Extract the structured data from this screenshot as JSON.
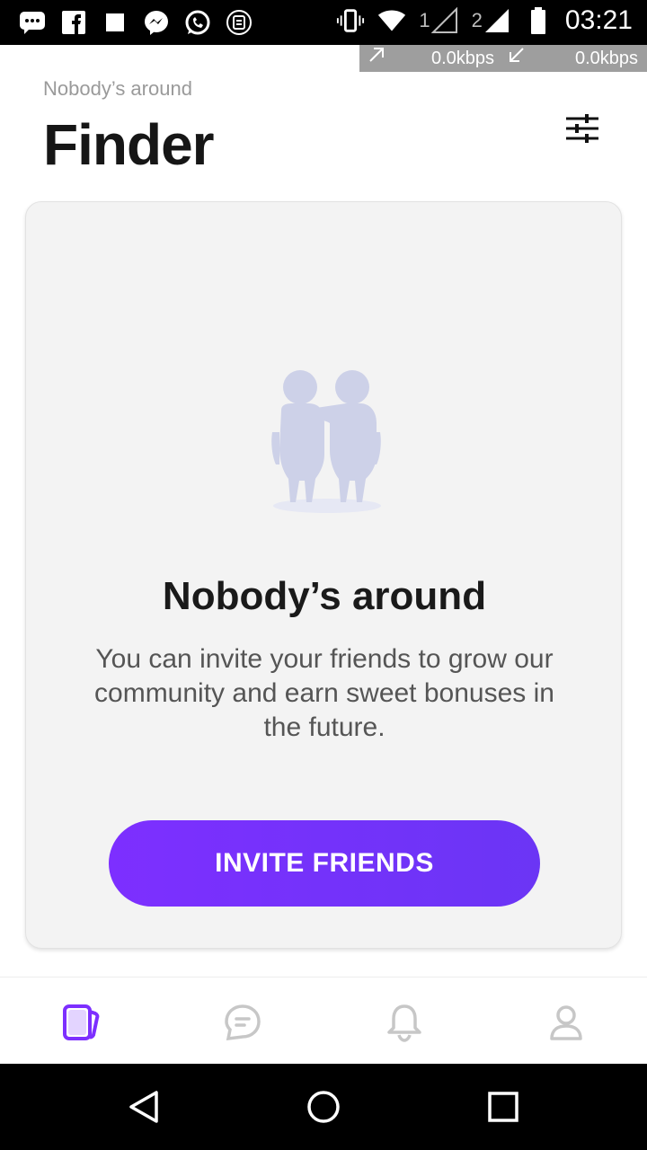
{
  "status_bar": {
    "time": "03:21",
    "sim1": "1",
    "sim2": "2",
    "icons": [
      "messages-icon",
      "facebook-icon",
      "square-icon",
      "messenger-icon",
      "whatsapp-icon",
      "tracker-icon"
    ]
  },
  "speed_overlay": {
    "upload": "0.0kbps",
    "download": "0.0kbps"
  },
  "header": {
    "subtitle": "Nobody’s around",
    "title": "Finder"
  },
  "empty_state": {
    "title": "Nobody’s around",
    "text": "You can invite your friends to grow our community and earn sweet bonuses in the future.",
    "button_label": "INVITE FRIENDS"
  },
  "bottom_nav": {
    "items": [
      {
        "icon": "cards-icon",
        "active": true
      },
      {
        "icon": "chat-icon",
        "active": false
      },
      {
        "icon": "bell-icon",
        "active": false
      },
      {
        "icon": "profile-icon",
        "active": false
      }
    ]
  },
  "colors": {
    "accent": "#7d2fff",
    "illustration": "#cdd1e8",
    "inactive_icon": "#c7c7c7"
  }
}
